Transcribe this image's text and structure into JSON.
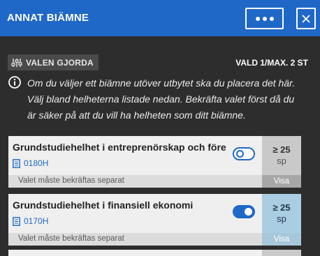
{
  "header": {
    "title": "ANNAT BIÄMNE",
    "more_icon": "ellipsis-icon",
    "close_icon": "close-icon"
  },
  "status": {
    "badge_icon": "sliders-icon",
    "badge_label": "VALEN GJORDA",
    "count_label": "VALD 1/MAX. 2 ST"
  },
  "info": {
    "icon": "info-icon",
    "text": "Om du väljer ett biämne utöver utbytet ska du placera det här. Välj bland helheterna listade nedan. Bekräfta valet först då du är säker på att du vill ha helheten som ditt biämne."
  },
  "cards": [
    {
      "title": "Grundstudiehelhet i entreprenörskap och företagsamhet",
      "code": "0180H",
      "selected": false,
      "credits": "≥ 25",
      "unit": "sp",
      "note": "Valet måste bekräftas separat",
      "action": "Visa"
    },
    {
      "title": "Grundstudiehelhet i finansiell ekonomi",
      "code": "0170H",
      "selected": true,
      "credits": "≥ 25",
      "unit": "sp",
      "note": "Valet måste bekräftas separat",
      "action": "Visa"
    }
  ],
  "colors": {
    "header_bg": "#1f68c7",
    "panel_bg": "#2d2d2d",
    "accent": "#1f68c7"
  }
}
